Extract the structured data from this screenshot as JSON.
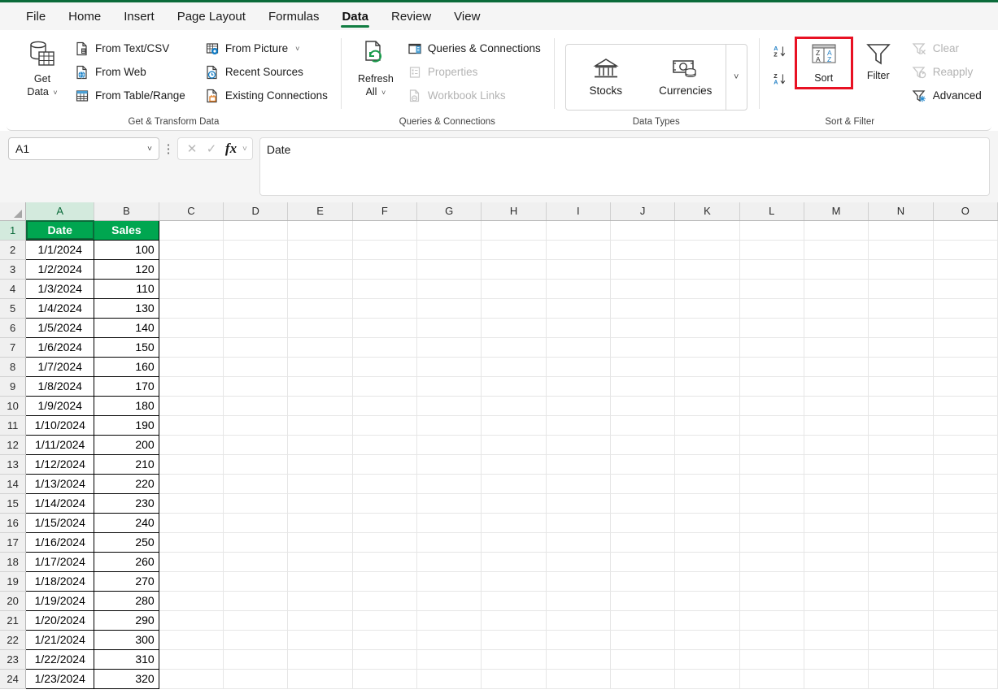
{
  "ribbon": {
    "tabs": [
      {
        "label": "File",
        "active": false
      },
      {
        "label": "Home",
        "active": false
      },
      {
        "label": "Insert",
        "active": false
      },
      {
        "label": "Page Layout",
        "active": false
      },
      {
        "label": "Formulas",
        "active": false
      },
      {
        "label": "Data",
        "active": true
      },
      {
        "label": "Review",
        "active": false
      },
      {
        "label": "View",
        "active": false
      }
    ],
    "accent_green": "#107c41",
    "highlight_red": "#e81123",
    "groups": {
      "get_transform": {
        "label": "Get & Transform Data",
        "get_data": {
          "line1": "Get",
          "line2": "Data",
          "caret": "˅"
        },
        "items_col1": [
          {
            "label": "From Text/CSV",
            "icon": "file-text-csv-icon",
            "disabled": false
          },
          {
            "label": "From Web",
            "icon": "file-globe-icon",
            "disabled": false
          },
          {
            "label": "From Table/Range",
            "icon": "table-grid-icon",
            "disabled": false
          }
        ],
        "items_col2": [
          {
            "label": "From Picture",
            "icon": "picture-camera-icon",
            "disabled": false,
            "caret": "˅"
          },
          {
            "label": "Recent Sources",
            "icon": "file-clock-icon",
            "disabled": false
          },
          {
            "label": "Existing Connections",
            "icon": "file-plug-icon",
            "disabled": false
          }
        ]
      },
      "queries": {
        "label": "Queries & Connections",
        "refresh": {
          "line1": "Refresh",
          "line2": "All",
          "caret": "˅",
          "icon": "refresh-all-icon"
        },
        "items": [
          {
            "label": "Queries & Connections",
            "icon": "queries-pane-icon",
            "disabled": false
          },
          {
            "label": "Properties",
            "icon": "properties-icon",
            "disabled": true
          },
          {
            "label": "Workbook Links",
            "icon": "workbook-links-icon",
            "disabled": true
          }
        ]
      },
      "data_types": {
        "label": "Data Types",
        "items": [
          {
            "label": "Stocks",
            "icon": "bank-building-icon"
          },
          {
            "label": "Currencies",
            "icon": "banknote-coins-icon"
          }
        ],
        "more": "˅"
      },
      "sort_filter": {
        "label": "Sort & Filter",
        "sort_ascending": {
          "name": "sort-a-to-z",
          "top": "A",
          "bottom": "Z"
        },
        "sort_descending": {
          "name": "sort-z-to-a",
          "top": "Z",
          "bottom": "A"
        },
        "sort": {
          "label": "Sort",
          "icon": "sort-dialog-icon",
          "glyph_left_top": "Z",
          "glyph_left_bottom": "A",
          "glyph_right_top": "A",
          "glyph_right_bottom": "Z",
          "highlighted": true
        },
        "filter": {
          "label": "Filter",
          "icon": "funnel-icon"
        },
        "items": [
          {
            "label": "Clear",
            "icon": "funnel-clear-icon",
            "disabled": true
          },
          {
            "label": "Reapply",
            "icon": "funnel-reapply-icon",
            "disabled": true
          },
          {
            "label": "Advanced",
            "icon": "funnel-advanced-icon",
            "disabled": false
          }
        ]
      }
    }
  },
  "formula_bar": {
    "name_box_value": "A1",
    "name_box_caret": "˅",
    "cancel_icon": "✕",
    "enter_icon": "✓",
    "fx_label": "fx",
    "fx_caret": "˅",
    "more_icon": "⋮",
    "formula_value": "Date"
  },
  "grid": {
    "columns": [
      "A",
      "B",
      "C",
      "D",
      "E",
      "F",
      "G",
      "H",
      "I",
      "J",
      "K",
      "L",
      "M",
      "N",
      "O"
    ],
    "selected_column": "A",
    "selected_row": "1",
    "header_fill": "#00a650",
    "header_text_color": "#ffffff",
    "rows": [
      {
        "n": "1",
        "a": "Date",
        "b": "Sales",
        "header": true
      },
      {
        "n": "2",
        "a": "1/1/2024",
        "b": "100"
      },
      {
        "n": "3",
        "a": "1/2/2024",
        "b": "120"
      },
      {
        "n": "4",
        "a": "1/3/2024",
        "b": "110"
      },
      {
        "n": "5",
        "a": "1/4/2024",
        "b": "130"
      },
      {
        "n": "6",
        "a": "1/5/2024",
        "b": "140"
      },
      {
        "n": "7",
        "a": "1/6/2024",
        "b": "150"
      },
      {
        "n": "8",
        "a": "1/7/2024",
        "b": "160"
      },
      {
        "n": "9",
        "a": "1/8/2024",
        "b": "170"
      },
      {
        "n": "10",
        "a": "1/9/2024",
        "b": "180"
      },
      {
        "n": "11",
        "a": "1/10/2024",
        "b": "190"
      },
      {
        "n": "12",
        "a": "1/11/2024",
        "b": "200"
      },
      {
        "n": "13",
        "a": "1/12/2024",
        "b": "210"
      },
      {
        "n": "14",
        "a": "1/13/2024",
        "b": "220"
      },
      {
        "n": "15",
        "a": "1/14/2024",
        "b": "230"
      },
      {
        "n": "16",
        "a": "1/15/2024",
        "b": "240"
      },
      {
        "n": "17",
        "a": "1/16/2024",
        "b": "250"
      },
      {
        "n": "18",
        "a": "1/17/2024",
        "b": "260"
      },
      {
        "n": "19",
        "a": "1/18/2024",
        "b": "270"
      },
      {
        "n": "20",
        "a": "1/19/2024",
        "b": "280"
      },
      {
        "n": "21",
        "a": "1/20/2024",
        "b": "290"
      },
      {
        "n": "22",
        "a": "1/21/2024",
        "b": "300"
      },
      {
        "n": "23",
        "a": "1/22/2024",
        "b": "310"
      },
      {
        "n": "24",
        "a": "1/23/2024",
        "b": "320"
      }
    ]
  }
}
